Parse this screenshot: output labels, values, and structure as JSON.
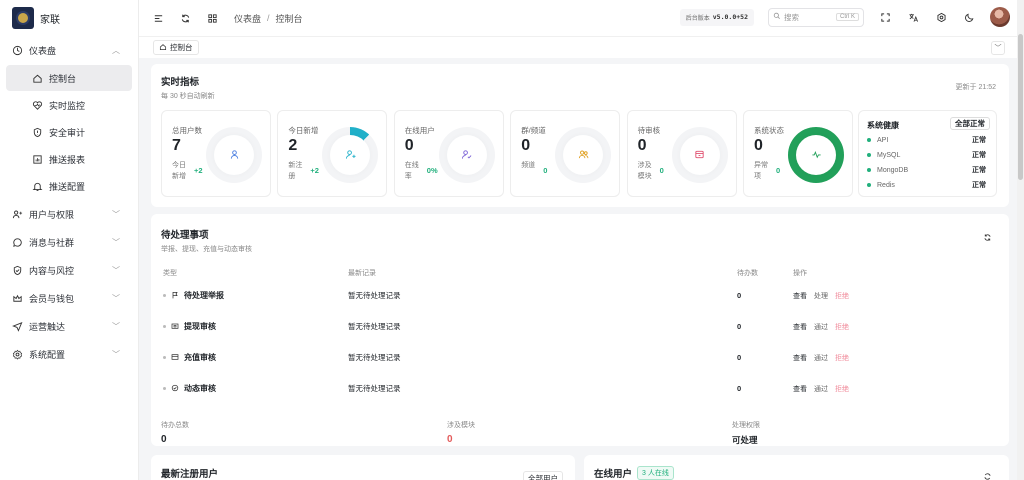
{
  "brand": {
    "name": "家联"
  },
  "sidebar": {
    "groups": [
      {
        "label": "仪表盘",
        "icon": "dashboard-icon"
      },
      {
        "label": "用户与权限",
        "icon": "users-icon"
      },
      {
        "label": "消息与社群",
        "icon": "chat-icon"
      },
      {
        "label": "内容与风控",
        "icon": "shield-check-icon"
      },
      {
        "label": "会员与钱包",
        "icon": "crown-icon"
      },
      {
        "label": "运营触达",
        "icon": "send-icon"
      },
      {
        "label": "系统配置",
        "icon": "gear-icon"
      }
    ],
    "dashboard_items": [
      {
        "label": "控制台",
        "icon": "home-icon"
      },
      {
        "label": "实时监控",
        "icon": "heart-monitor-icon"
      },
      {
        "label": "安全审计",
        "icon": "shield-alert-icon"
      },
      {
        "label": "推送报表",
        "icon": "report-icon"
      },
      {
        "label": "推送配置",
        "icon": "bell-icon"
      }
    ]
  },
  "header": {
    "breadcrumb": [
      "仪表盘",
      "控制台"
    ],
    "version_label": "后台版本",
    "version_value": "v5.0.0+52",
    "search_placeholder": "搜索",
    "search_shortcut": "Ctrl K"
  },
  "tabs": [
    {
      "label": "控制台"
    }
  ],
  "realtime": {
    "title": "实时指标",
    "subtitle": "每 30 秒自动刷新",
    "updated": "更新于 21:52",
    "metrics": [
      {
        "label": "总用户数",
        "value": "7",
        "sub": "今日新增",
        "delta": "+2",
        "icon": "user-icon",
        "color": "#4a7ee0"
      },
      {
        "label": "今日新增",
        "value": "2",
        "sub": "新注册",
        "delta": "+2",
        "icon": "user-plus-icon",
        "color": "#21b0c9",
        "progress": 0.12
      },
      {
        "label": "在线用户",
        "value": "0",
        "sub": "在线率",
        "delta": "0%",
        "icon": "user-check-icon",
        "color": "#7b61d6"
      },
      {
        "label": "群/频道",
        "value": "0",
        "sub": "频道",
        "delta": "0",
        "icon": "group-icon",
        "color": "#e0a020"
      },
      {
        "label": "待审核",
        "value": "0",
        "sub": "涉及模块",
        "delta": "0",
        "icon": "inbox-icon",
        "color": "#e04e6e"
      },
      {
        "label": "系统状态",
        "value": "0",
        "sub": "异常项",
        "delta": "0",
        "icon": "pulse-icon",
        "color": "#22a05a",
        "progress": 1.0
      }
    ],
    "health": {
      "title": "系统健康",
      "badge": "全部正常",
      "items": [
        {
          "name": "API",
          "status": "正常"
        },
        {
          "name": "MySQL",
          "status": "正常"
        },
        {
          "name": "MongoDB",
          "status": "正常"
        },
        {
          "name": "Redis",
          "status": "正常"
        }
      ]
    }
  },
  "pending": {
    "title": "待处理事项",
    "subtitle": "举报、提现、充值与动态审核",
    "columns": [
      "类型",
      "最新记录",
      "待办数",
      "操作"
    ],
    "rows": [
      {
        "type": "待处理举报",
        "icon": "flag-icon",
        "latest": "暂无待处理记录",
        "count": "0",
        "ops": [
          "查看",
          "处理",
          "拒绝"
        ]
      },
      {
        "type": "提现审核",
        "icon": "wallet-icon",
        "latest": "暂无待处理记录",
        "count": "0",
        "ops": [
          "查看",
          "通过",
          "拒绝"
        ]
      },
      {
        "type": "充值审核",
        "icon": "card-icon",
        "latest": "暂无待处理记录",
        "count": "0",
        "ops": [
          "查看",
          "通过",
          "拒绝"
        ]
      },
      {
        "type": "动态审核",
        "icon": "check-circle-icon",
        "latest": "暂无待处理记录",
        "count": "0",
        "ops": [
          "查看",
          "通过",
          "拒绝"
        ]
      }
    ],
    "summary": [
      {
        "label": "待办总数",
        "value": "0"
      },
      {
        "label": "涉及模块",
        "value": "0"
      },
      {
        "label": "处理权限",
        "value": "可处理"
      }
    ]
  },
  "bottom": {
    "left_title": "最新注册用户",
    "left_link": "全部用户",
    "right_title": "在线用户",
    "right_badge": "3 人在线"
  },
  "colors": {
    "accent_green": "#22b07d",
    "danger": "#e35a5a"
  }
}
